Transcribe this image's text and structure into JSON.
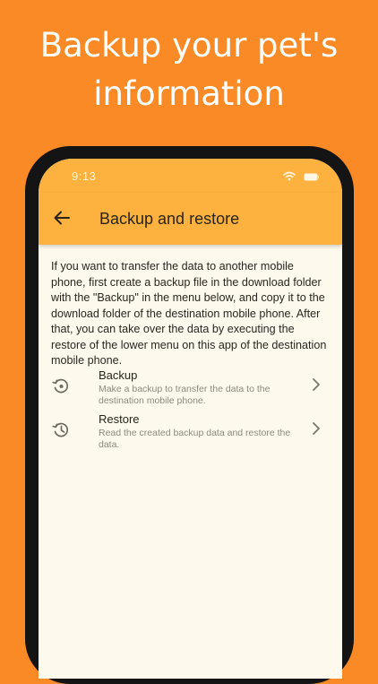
{
  "promo": {
    "headline": "Backup your pet's\ninformation"
  },
  "status_bar": {
    "time": "9:13",
    "icons": [
      "wifi-icon",
      "battery-icon"
    ]
  },
  "app_bar": {
    "back_icon": "arrow-left-icon",
    "title": "Backup and restore"
  },
  "description": "If you want to transfer the data to another mobile phone, first create a backup file in the download folder with the \"Backup\" in the menu below, and copy it to the download folder of the destination mobile phone. After that, you can take over the data by executing the restore of the lower menu on this app of the destination mobile phone.",
  "menu": [
    {
      "icon": "backup-icon",
      "title": "Backup",
      "subtitle": "Make a backup to transfer the data to the destination mobile phone."
    },
    {
      "icon": "restore-icon",
      "title": "Restore",
      "subtitle": "Read the created backup data and restore the data."
    }
  ],
  "colors": {
    "background": "#fa8a26",
    "app_bar": "#fdb23f",
    "screen": "#fdf9ec"
  }
}
